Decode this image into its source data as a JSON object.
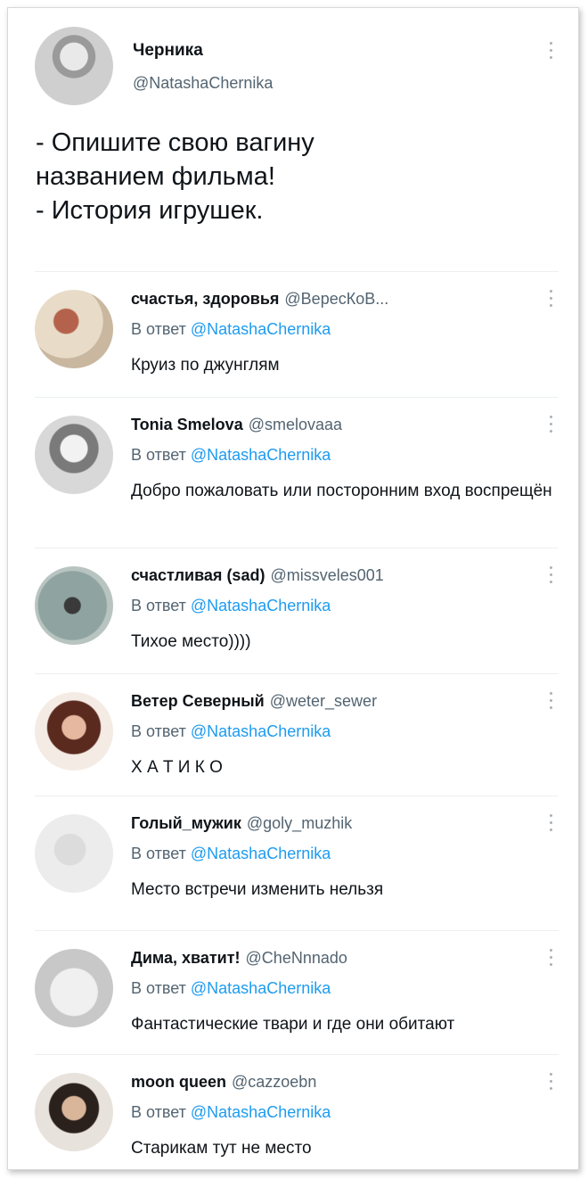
{
  "tweet": {
    "name": "Черника",
    "handle": "@NatashaChernika",
    "text": "- Опишите свою вагину\nназванием фильма!\n- История игрушек."
  },
  "replies": [
    {
      "name": "счастья, здоровья",
      "handle": "@ВересКоВ...",
      "reply_prefix": "В ответ",
      "mention": "@NatashaChernika",
      "text": "Круиз по джунглям"
    },
    {
      "name": "Tonia Smelova",
      "handle": "@smelovaaa",
      "reply_prefix": "В ответ",
      "mention": "@NatashaChernika",
      "text": "Добро пожаловать или посторонним вход воспрещён"
    },
    {
      "name": "счастливая (sad)",
      "handle": "@missveles001",
      "reply_prefix": "В ответ",
      "mention": "@NatashaChernika",
      "text": "Тихое место))))"
    },
    {
      "name": "Ветер Северный",
      "handle": "@weter_sewer",
      "reply_prefix": "В ответ",
      "mention": "@NatashaChernika",
      "text": "Х А Т И К О"
    },
    {
      "name": "Голый_мужик",
      "handle": "@goly_muzhik",
      "reply_prefix": "В ответ",
      "mention": "@NatashaChernika",
      "text": "Место встречи изменить нельзя"
    },
    {
      "name": "Дима, хватит!",
      "handle": "@CheNnnado",
      "reply_prefix": "В ответ",
      "mention": "@NatashaChernika",
      "text": "Фантастические твари и где они обитают"
    },
    {
      "name": "moon queen",
      "handle": "@cazzoebn",
      "reply_prefix": "В ответ",
      "mention": "@NatashaChernika",
      "text": "Старикам тут не место"
    }
  ],
  "colors": {
    "name": "#0f1419",
    "secondary": "#536471",
    "mention": "#1d9bf0",
    "divider": "#eceff1"
  },
  "icons": {
    "more": "more-vertical-icon"
  }
}
